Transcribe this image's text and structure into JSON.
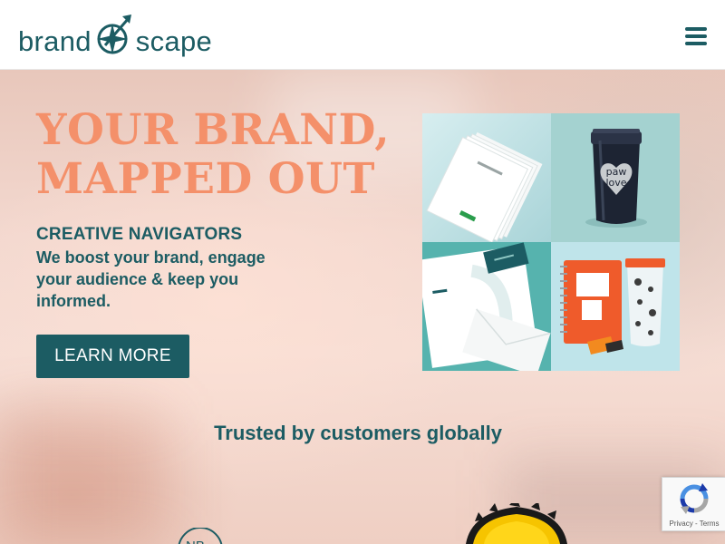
{
  "header": {
    "logo": {
      "left_text": "brand",
      "right_text": "scape"
    },
    "menu_icon": "hamburger-menu-icon"
  },
  "hero": {
    "headline_line1": "YOUR BRAND,",
    "headline_line2": "MAPPED OUT",
    "subtitle": "CREATIVE NAVIGATORS",
    "description": "We boost your brand, engage your audience & keep you informed.",
    "cta_label": "LEARN MORE",
    "gallery": [
      {
        "name": "envelopes-product-image"
      },
      {
        "name": "tumbler-product-image"
      },
      {
        "name": "stationery-product-image"
      },
      {
        "name": "notebook-cup-product-image"
      }
    ]
  },
  "trusted": {
    "heading": "Trusted by customers globally",
    "logo_partial_text": "NB"
  },
  "recaptcha": {
    "privacy_label": "Privacy",
    "separator": " - ",
    "terms_label": "Terms"
  },
  "colors": {
    "brand_teal": "#1c5c63",
    "headline_coral": "#f4906a",
    "tumbler_background": "#a4d2d0",
    "stationery_background": "#56b3ae"
  }
}
